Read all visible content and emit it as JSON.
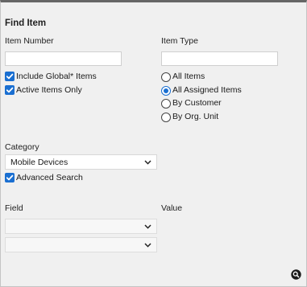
{
  "title": "Find Item",
  "item_number": {
    "label": "Item Number",
    "value": "",
    "include_global_label": "Include Global* Items",
    "active_only_label": "Active Items Only"
  },
  "item_type": {
    "label": "Item Type",
    "value": "",
    "options": [
      "All Items",
      "All Assigned Items",
      "By Customer",
      "By Org. Unit"
    ],
    "selected": "All Assigned Items"
  },
  "category": {
    "label": "Category",
    "selected": "Mobile Devices",
    "advanced_label": "Advanced Search"
  },
  "advanced": {
    "field_label": "Field",
    "value_label": "Value",
    "field1": "",
    "field2": ""
  },
  "colors": {
    "accent": "#1a6fd1",
    "panel_bg": "#f0f0f0",
    "top_border": "#666666"
  },
  "icons": {
    "checkbox": "checkmark-icon",
    "dropdown": "chevron-down-icon",
    "search": "magnifier-icon"
  }
}
